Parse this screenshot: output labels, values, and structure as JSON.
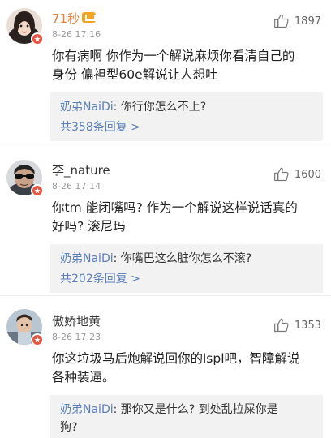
{
  "comments": [
    {
      "username": "71秒",
      "time": "8-26 17:16",
      "likes": "1897",
      "text_line1": "你有病啊 你作为一个解说麻烦你看清自己的",
      "text_line2": "身份 偏袒型60e解说让人想吐",
      "reply": {
        "name": "奶弟NaiDi",
        "text": ": 你行你怎么不上?",
        "text_line2": ""
      },
      "reply_count": "共358条回复 >"
    },
    {
      "username": "李_nature",
      "time": "8-26 17:14",
      "likes": "1600",
      "text_line1": "你tm 能闭嘴吗? 作为一个解说这样说话真的",
      "text_line2": "好吗? 滚尼玛",
      "reply": {
        "name": "奶弟NaiDi",
        "text": ": 你嘴巴这么脏你怎么不滚?",
        "text_line2": ""
      },
      "reply_count": "共202条回复 >"
    },
    {
      "username": "傲娇地黄",
      "time": "8-26 17:23",
      "likes": "1353",
      "text_line1": "你这垃圾马后炮解说回你的lspl吧，智障解说",
      "text_line2": "各种装逼。",
      "reply": {
        "name": "奶弟NaiDi",
        "text": ": 那你又是什么? 到处乱拉屎你是",
        "text_line2": "狗?"
      },
      "reply_count": ""
    }
  ]
}
